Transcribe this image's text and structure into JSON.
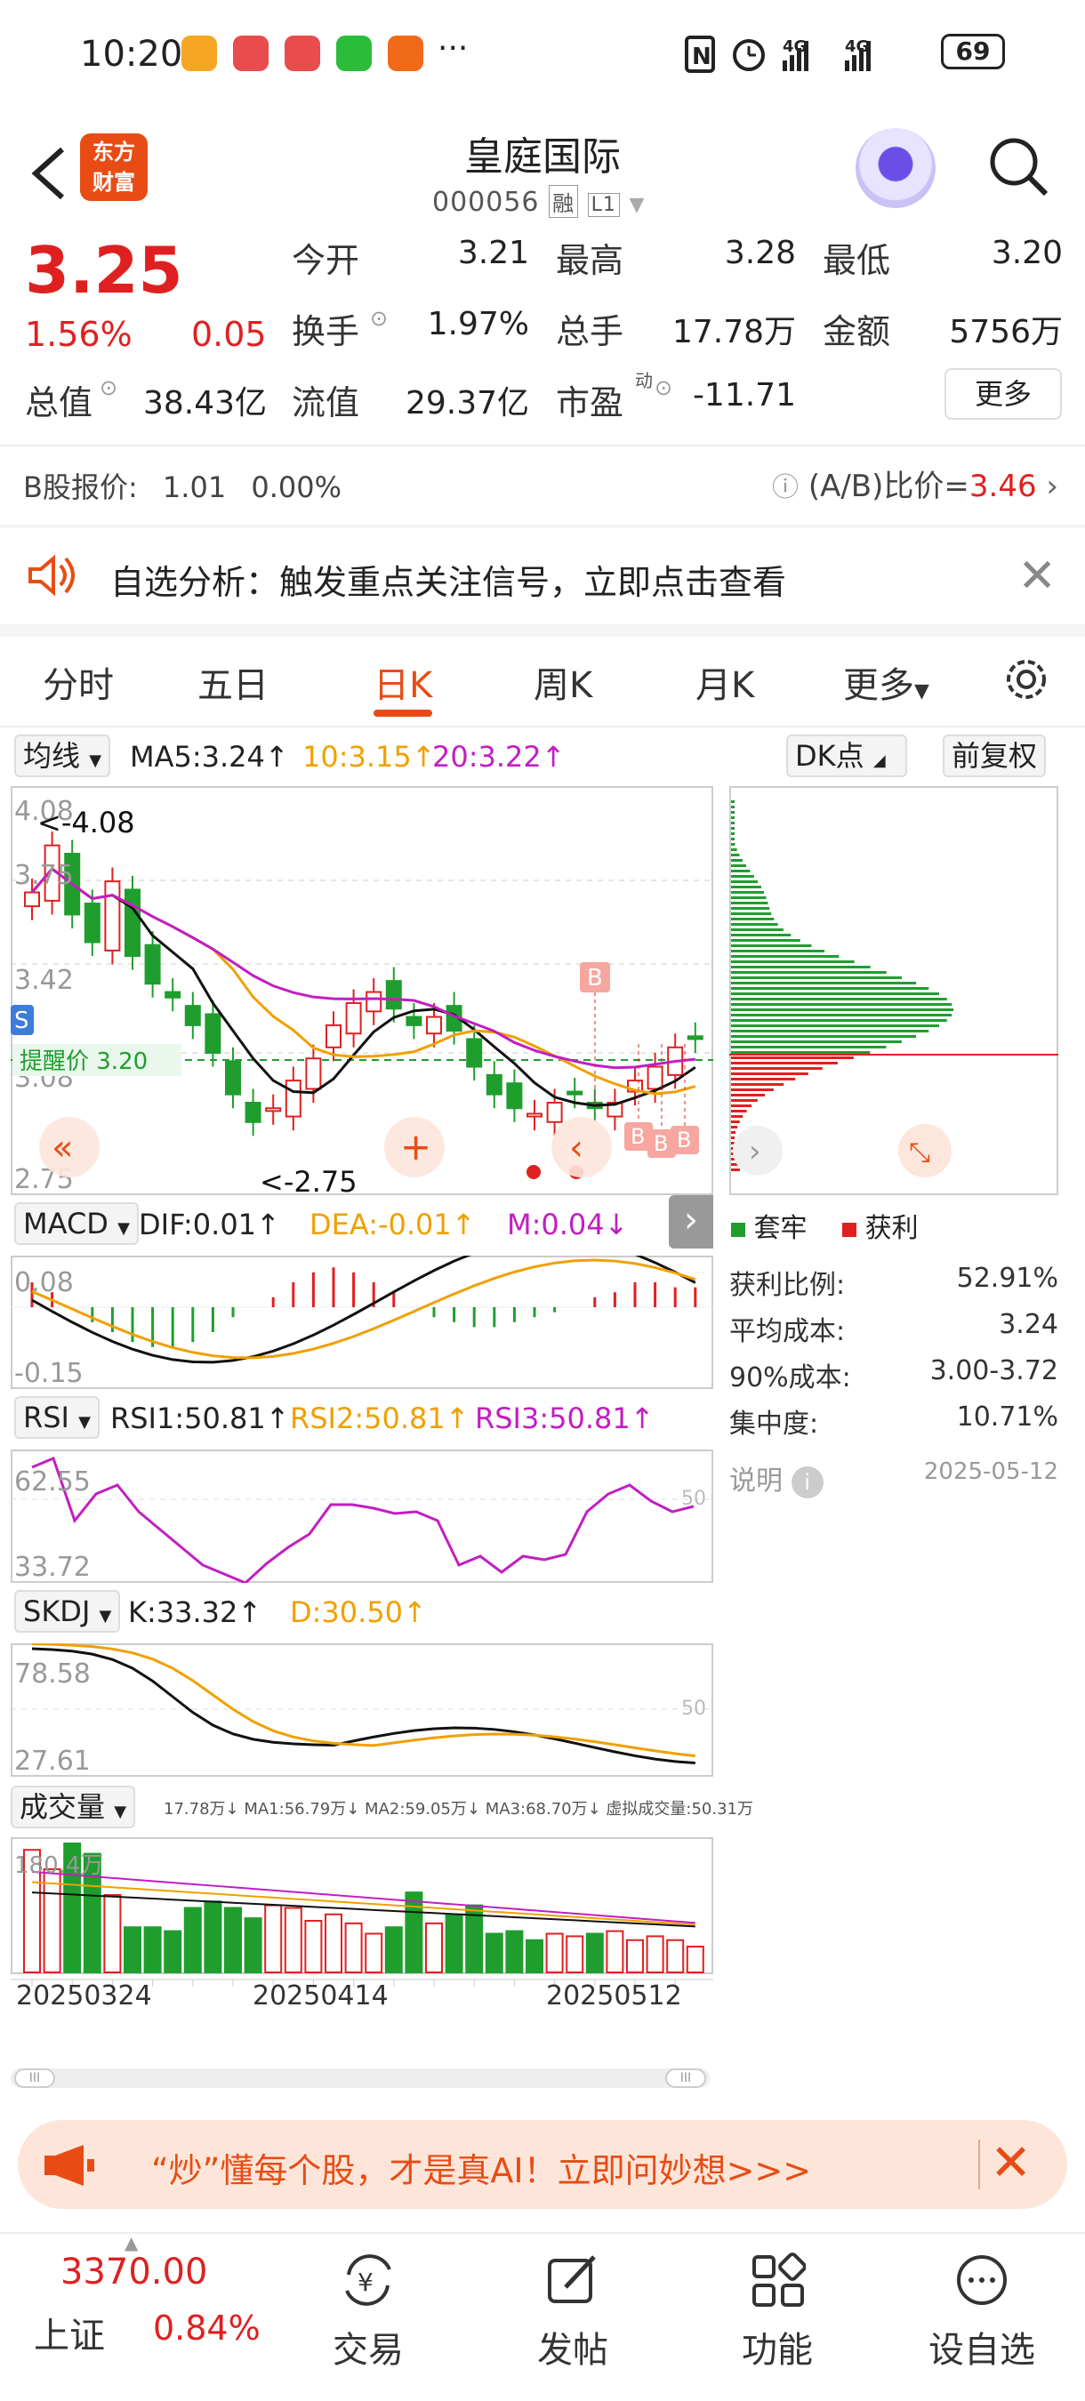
{
  "status_bar": {
    "time": "10:20",
    "more": "···",
    "network": "4G 4G",
    "battery": "69"
  },
  "header": {
    "logo_text_line1": "东方",
    "logo_text_line2": "财富",
    "stock_name": "皇庭国际",
    "stock_code": "000056",
    "badge_margin": "融",
    "badge_level": "L1"
  },
  "quote": {
    "price": "3.25",
    "change_pct": "1.56%",
    "change_amt": "0.05",
    "open_label": "今开",
    "open_value": "3.21",
    "high_label": "最高",
    "high_value": "3.28",
    "low_label": "最低",
    "low_value": "3.20",
    "turnover_label": "换手",
    "turnover_value": "1.97%",
    "volume_label": "总手",
    "volume_value": "17.78万",
    "amount_label": "金额",
    "amount_value": "5756万",
    "mktcap_label": "总值",
    "mktcap_value": "38.43亿",
    "float_label": "流值",
    "float_value": "29.37亿",
    "pe_label": "市盈",
    "pe_superscript": "动",
    "pe_value": "-11.71",
    "more_button": "更多"
  },
  "b_share": {
    "label": "B股报价:",
    "price": "1.01",
    "pct": "0.00%",
    "ratio_label": "(A/B)比价=",
    "ratio_value": "3.46"
  },
  "alert": {
    "text": "自选分析：触发重点关注信号，立即点击查看"
  },
  "tabs": [
    "分时",
    "五日",
    "日K",
    "周K",
    "月K",
    "更多"
  ],
  "active_tab": "日K",
  "kline": {
    "ma_selector": "均线",
    "ma5": "MA5:3.24",
    "ma10": "10:3.15",
    "ma20": "20:3.22",
    "dk_button": "DK点",
    "adjust_button": "前复权",
    "y_top": "4.08",
    "y_mid1": "3.75",
    "y_mid2": "3.42",
    "y_mid3": "3.08",
    "y_bottom": "2.75",
    "max_label": "<-4.08",
    "min_label": "<-2.75",
    "reminder_label": "提醒价 3.20",
    "s_marker": "S",
    "b_marker": "B"
  },
  "macd": {
    "selector": "MACD",
    "dif": "DIF:0.01",
    "dea": "DEA:-0.01",
    "m": "M:0.04",
    "y_top": "0.08",
    "y_bottom": "-0.15"
  },
  "rsi": {
    "selector": "RSI",
    "rsi1": "RSI1:50.81",
    "rsi2": "RSI2:50.81",
    "rsi3": "RSI3:50.81",
    "y_top": "62.55",
    "y_bottom": "33.72",
    "ref": "50"
  },
  "skdj": {
    "selector": "SKDJ",
    "k": "K:33.32",
    "d": "D:30.50",
    "y_top": "78.58",
    "y_bottom": "27.61",
    "ref": "50"
  },
  "volume": {
    "selector": "成交量",
    "summary": "17.78万↓ MA1:56.79万↓ MA2:59.05万↓ MA3:68.70万↓ 虚拟成交量:50.31万",
    "y_top": "180.4万",
    "dates": [
      "20250324",
      "20250414",
      "20250512"
    ]
  },
  "chips": {
    "legend_trapped": "套牢",
    "legend_profit": "获利",
    "profit_ratio_label": "获利比例:",
    "profit_ratio_value": "52.91%",
    "avg_cost_label": "平均成本:",
    "avg_cost_value": "3.24",
    "cost90_label": "90%成本:",
    "cost90_value": "3.00-3.72",
    "concentration_label": "集中度:",
    "concentration_value": "10.71%",
    "explain_label": "说明",
    "date": "2025-05-12"
  },
  "banner": {
    "text": "“炒”懂每个股，才是真AI！立即问妙想>>>"
  },
  "bottom_nav": {
    "index_value": "3370.00",
    "index_name": "上证",
    "index_pct": "0.84%",
    "items": [
      "交易",
      "发帖",
      "功能",
      "设自选"
    ]
  },
  "colors": {
    "up": "#e02020",
    "down": "#1f9e2e",
    "brand": "#e84c14",
    "ma10": "#f0a000",
    "ma20": "#c21ec2"
  }
}
